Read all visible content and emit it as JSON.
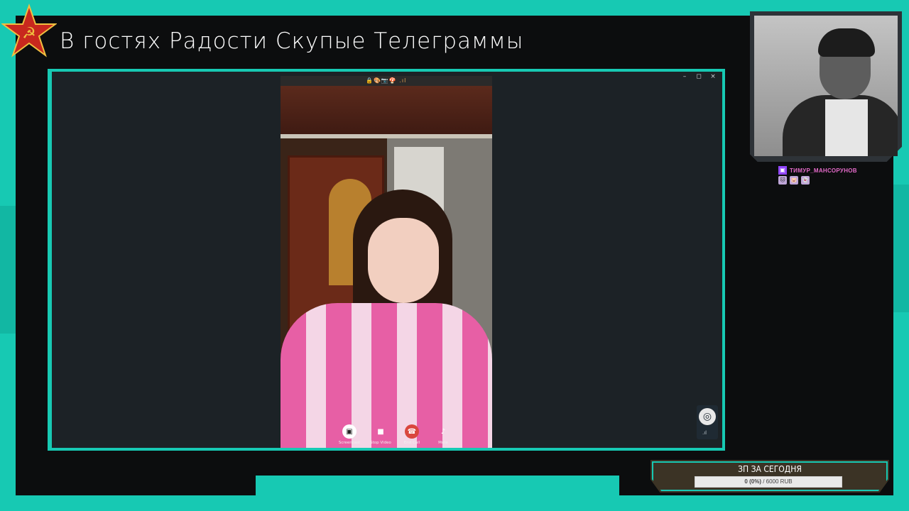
{
  "overlay": {
    "title": "В гостях Радости Скупые Телеграммы",
    "accent_color": "#17c9b3"
  },
  "call": {
    "status_icons": "🔒🎨📷🍄 .ıl",
    "window_controls": {
      "minimize": "–",
      "maximize": "◻",
      "close": "×"
    },
    "actions": [
      {
        "label": "Screencast",
        "icon": "screencast-icon"
      },
      {
        "label": "Stop Video",
        "icon": "video-icon"
      },
      {
        "label": "End Call",
        "icon": "end-call-icon"
      },
      {
        "label": "Mute",
        "icon": "microphone-icon"
      }
    ],
    "obs_badge": "OBS"
  },
  "webcam": {
    "twitch_username": "ТИМУР_МАНСОРУНОВ"
  },
  "goal": {
    "title": "ЗП ЗА СЕГОДНЯ",
    "current_text": "0 (0%)",
    "target_text": " / 6000 RUB",
    "progress": 0
  }
}
